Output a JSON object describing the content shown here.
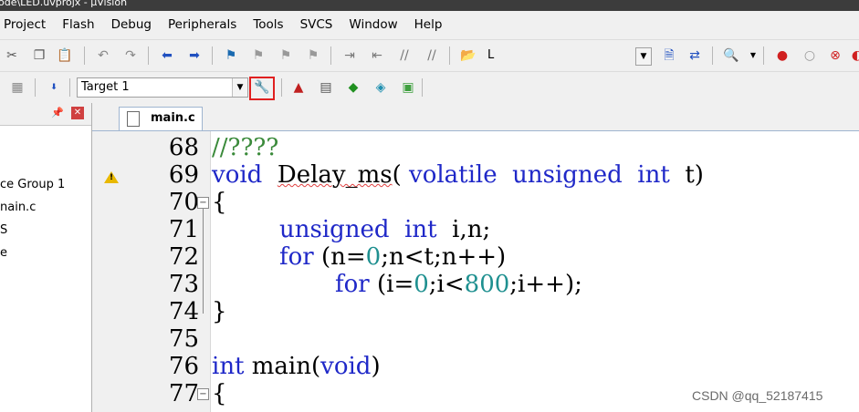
{
  "window": {
    "title": "ode\\LED.uvprojx - µVision"
  },
  "menu": [
    {
      "label": "Project"
    },
    {
      "label": "Flash"
    },
    {
      "label": "Debug"
    },
    {
      "label": "Peripherals"
    },
    {
      "label": "Tools"
    },
    {
      "label": "SVCS"
    },
    {
      "label": "Window"
    },
    {
      "label": "Help"
    }
  ],
  "toolbar1": {
    "find_text": "L"
  },
  "toolbar2": {
    "target": "Target 1"
  },
  "project_panel": {
    "items": [
      "ce Group 1",
      "nain.c",
      "S",
      "e"
    ]
  },
  "editor": {
    "tab_label": "main.c",
    "lines": [
      {
        "no": "68"
      },
      {
        "no": "69"
      },
      {
        "no": "70"
      },
      {
        "no": "71"
      },
      {
        "no": "72"
      },
      {
        "no": "73"
      },
      {
        "no": "74"
      },
      {
        "no": "75"
      },
      {
        "no": "76"
      },
      {
        "no": "77"
      }
    ],
    "tokens": {
      "l68": "//????",
      "l69_void": "void",
      "l69_fn": "Delay_ms",
      "l69_p1": "( ",
      "l69_volatile": "volatile",
      "l69_unsigned": "unsigned",
      "l69_int": "int",
      "l69_rest": "t)",
      "l70": "{",
      "l71_unsigned": "unsigned",
      "l71_int": "int",
      "l71_rest": "i,n;",
      "l72_for": "for",
      "l72_a": "(n=",
      "l72_zero": "0",
      "l72_b": ";n<t;n++)",
      "l73_for": "for",
      "l73_a": "(i=",
      "l73_zero": "0",
      "l73_b": ";i<",
      "l73_800": "800",
      "l73_c": ";i++);",
      "l74": "}",
      "l76_int": "int",
      "l76_main": " main(",
      "l76_void": "void",
      "l76_end": ")",
      "l77": "{"
    }
  },
  "watermark": "CSDN @qq_52187415",
  "colors": {
    "keyword": "#1f28c8",
    "comment": "#3a8a3a",
    "number": "#1f9090",
    "highlight": "#e02020"
  }
}
